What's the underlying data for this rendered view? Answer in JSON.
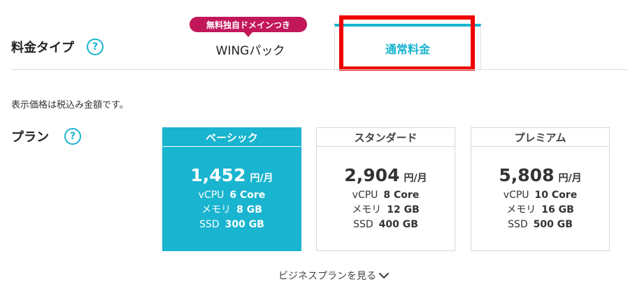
{
  "price_type": {
    "label": "料金タイプ",
    "help": "?",
    "tabs": [
      {
        "label": "WINGパック",
        "badge": "無料独自ドメインつき"
      },
      {
        "label": "通常料金"
      }
    ]
  },
  "tax_note": "表示価格は税込み金額です。",
  "plan": {
    "label": "プラン",
    "help": "?",
    "cards": [
      {
        "name": "ベーシック",
        "price": "1,452",
        "unit": "円/月",
        "cpu_label": "vCPU",
        "cpu": "6 Core",
        "mem_label": "メモリ",
        "mem": "8 GB",
        "ssd_label": "SSD",
        "ssd": "300 GB"
      },
      {
        "name": "スタンダード",
        "price": "2,904",
        "unit": "円/月",
        "cpu_label": "vCPU",
        "cpu": "8 Core",
        "mem_label": "メモリ",
        "mem": "12 GB",
        "ssd_label": "SSD",
        "ssd": "400 GB"
      },
      {
        "name": "プレミアム",
        "price": "5,808",
        "unit": "円/月",
        "cpu_label": "vCPU",
        "cpu": "10 Core",
        "mem_label": "メモリ",
        "mem": "16 GB",
        "ssd_label": "SSD",
        "ssd": "500 GB"
      }
    ]
  },
  "business_link": "ビジネスプランを見る",
  "colors": {
    "accent": "#19b4cf",
    "badge": "#c2185b",
    "highlight": "#ee0000"
  },
  "icons": {
    "help": "question-circle-icon",
    "more": "chevron-down-icon"
  }
}
